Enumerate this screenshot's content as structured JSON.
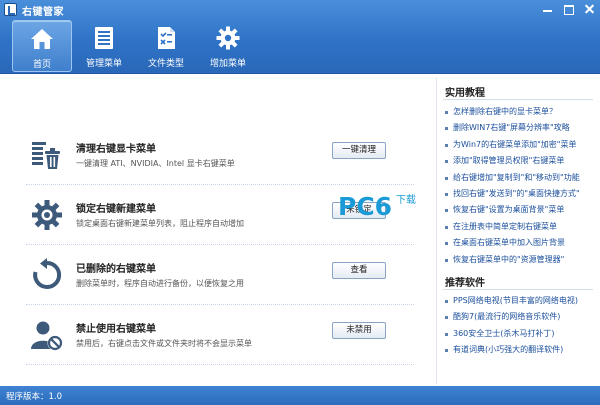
{
  "window": {
    "title": "右键管家"
  },
  "toolbar": {
    "items": [
      {
        "label": "首页",
        "icon": "home-icon"
      },
      {
        "label": "管理菜单",
        "icon": "list-icon"
      },
      {
        "label": "文件类型",
        "icon": "file-type-icon"
      },
      {
        "label": "增加菜单",
        "icon": "gear-icon"
      }
    ],
    "active": "首页"
  },
  "features": [
    {
      "title": "清理右键显卡菜单",
      "description": "一键清理 ATI、NVIDIA、Intel 显卡右键菜单",
      "button": "一键清理",
      "icon": "trash-icon"
    },
    {
      "title": "锁定右键新建菜单",
      "description": "锁定桌面右键新建菜单列表，阻止程序自动增加",
      "button": "未锁定",
      "icon": "gear-icon"
    },
    {
      "title": "已删除的右键菜单",
      "description": "删除菜单时，程序自动进行备份，以便恢复之用",
      "button": "查看",
      "icon": "restore-icon"
    },
    {
      "title": "禁止使用右键菜单",
      "description": "禁用后，右键点击文件或文件夹时将不会显示菜单",
      "button": "未禁用",
      "icon": "user-forbid-icon"
    }
  ],
  "tutorials": {
    "heading": "实用教程",
    "links": [
      "怎样删除右键中的显卡菜单？",
      "删除WIN7右键\"屏幕分辨率\"攻略",
      "为Win7的右键菜单添加\"加密\"菜单",
      "添加\"取得管理员权限\"右键菜单",
      "给右键增加\"复制到\"和\"移动到\"功能",
      "找回右键\"发送到\"的\"桌面快捷方式\"",
      "恢复右键\"设置为桌面背景\"菜单",
      "在注册表中简单定制右键菜单",
      "在桌面右键菜单中加入图片背景",
      "恢复右键菜单中的\"资源管理器\""
    ]
  },
  "software": {
    "heading": "推荐软件",
    "links": [
      "PPS网络电视(节目丰富的网络电视)",
      "酷狗7(最流行的网络音乐软件)",
      "360安全卫士(杀木马打补丁)",
      "有道词典(小巧强大的翻译软件)"
    ]
  },
  "watermark": {
    "brand": "PC6",
    "tag": "下载"
  },
  "status": {
    "version": "程序版本：1.0"
  },
  "colors": {
    "header": "#2f73c7",
    "link": "#1b4f9c",
    "watermark": "#1a9ad6"
  }
}
